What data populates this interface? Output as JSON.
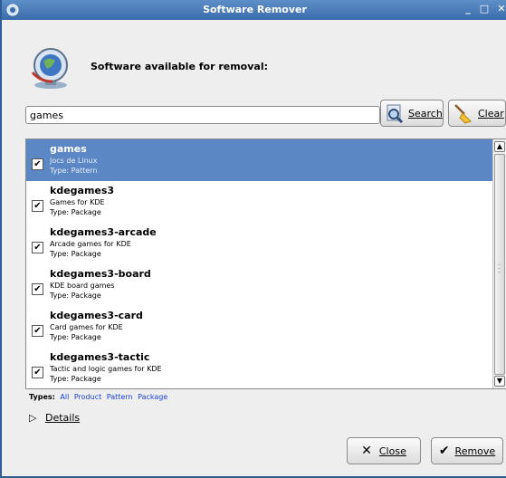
{
  "window": {
    "title": "Software Remover"
  },
  "header": {
    "text": "Software available for removal:"
  },
  "search": {
    "value": "games",
    "search_label": "Search",
    "clear_label": "Clear"
  },
  "list": {
    "items": [
      {
        "name": "games",
        "description": "Jocs de Linux",
        "type": "Type: Pattern",
        "checked": true,
        "selected": true
      },
      {
        "name": "kdegames3",
        "description": "Games for KDE",
        "type": "Type: Package",
        "checked": true,
        "selected": false
      },
      {
        "name": "kdegames3-arcade",
        "description": "Arcade games for KDE",
        "type": "Type: Package",
        "checked": true,
        "selected": false
      },
      {
        "name": "kdegames3-board",
        "description": "KDE board games",
        "type": "Type: Package",
        "checked": true,
        "selected": false
      },
      {
        "name": "kdegames3-card",
        "description": "Card games for KDE",
        "type": "Type: Package",
        "checked": true,
        "selected": false
      },
      {
        "name": "kdegames3-tactic",
        "description": "Tactic and logic games for KDE",
        "type": "Type: Package",
        "checked": true,
        "selected": false
      }
    ]
  },
  "types": {
    "label": "Types:",
    "links": [
      "All",
      "Product",
      "Pattern",
      "Package"
    ]
  },
  "details": {
    "label": "Details"
  },
  "footer": {
    "close_label": "Close",
    "remove_label": "Remove"
  },
  "colors": {
    "titlebar": "#3a6cab",
    "selection": "#5b87c4",
    "link": "#1a3fd6"
  }
}
